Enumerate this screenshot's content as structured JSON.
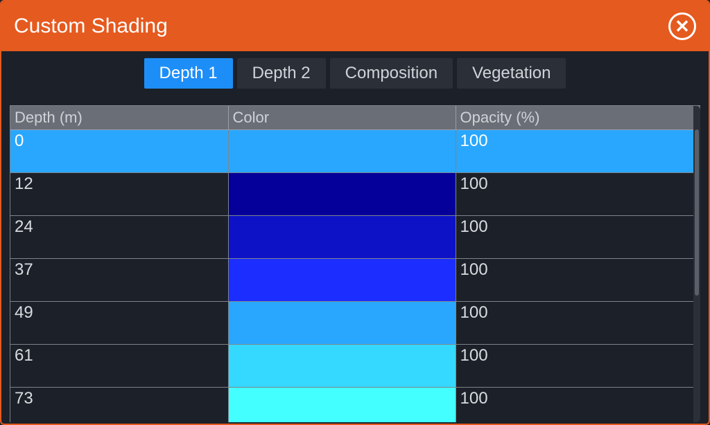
{
  "title": "Custom Shading",
  "tabs": [
    {
      "label": "Depth 1",
      "active": true
    },
    {
      "label": "Depth 2",
      "active": false
    },
    {
      "label": "Composition",
      "active": false
    },
    {
      "label": "Vegetation",
      "active": false
    }
  ],
  "columns": {
    "depth": "Depth (m)",
    "color": "Color",
    "opacity": "Opacity (%)"
  },
  "rows": [
    {
      "depth": "0",
      "color": "#29a7ff",
      "opacity": "100",
      "selected": true
    },
    {
      "depth": "12",
      "color": "#050099",
      "opacity": "100",
      "selected": false
    },
    {
      "depth": "24",
      "color": "#0e12c7",
      "opacity": "100",
      "selected": false
    },
    {
      "depth": "37",
      "color": "#1b2dff",
      "opacity": "100",
      "selected": false
    },
    {
      "depth": "49",
      "color": "#29a7ff",
      "opacity": "100",
      "selected": false
    },
    {
      "depth": "61",
      "color": "#35d8ff",
      "opacity": "100",
      "selected": false
    },
    {
      "depth": "73",
      "color": "#43ffff",
      "opacity": "100",
      "selected": false
    }
  ]
}
